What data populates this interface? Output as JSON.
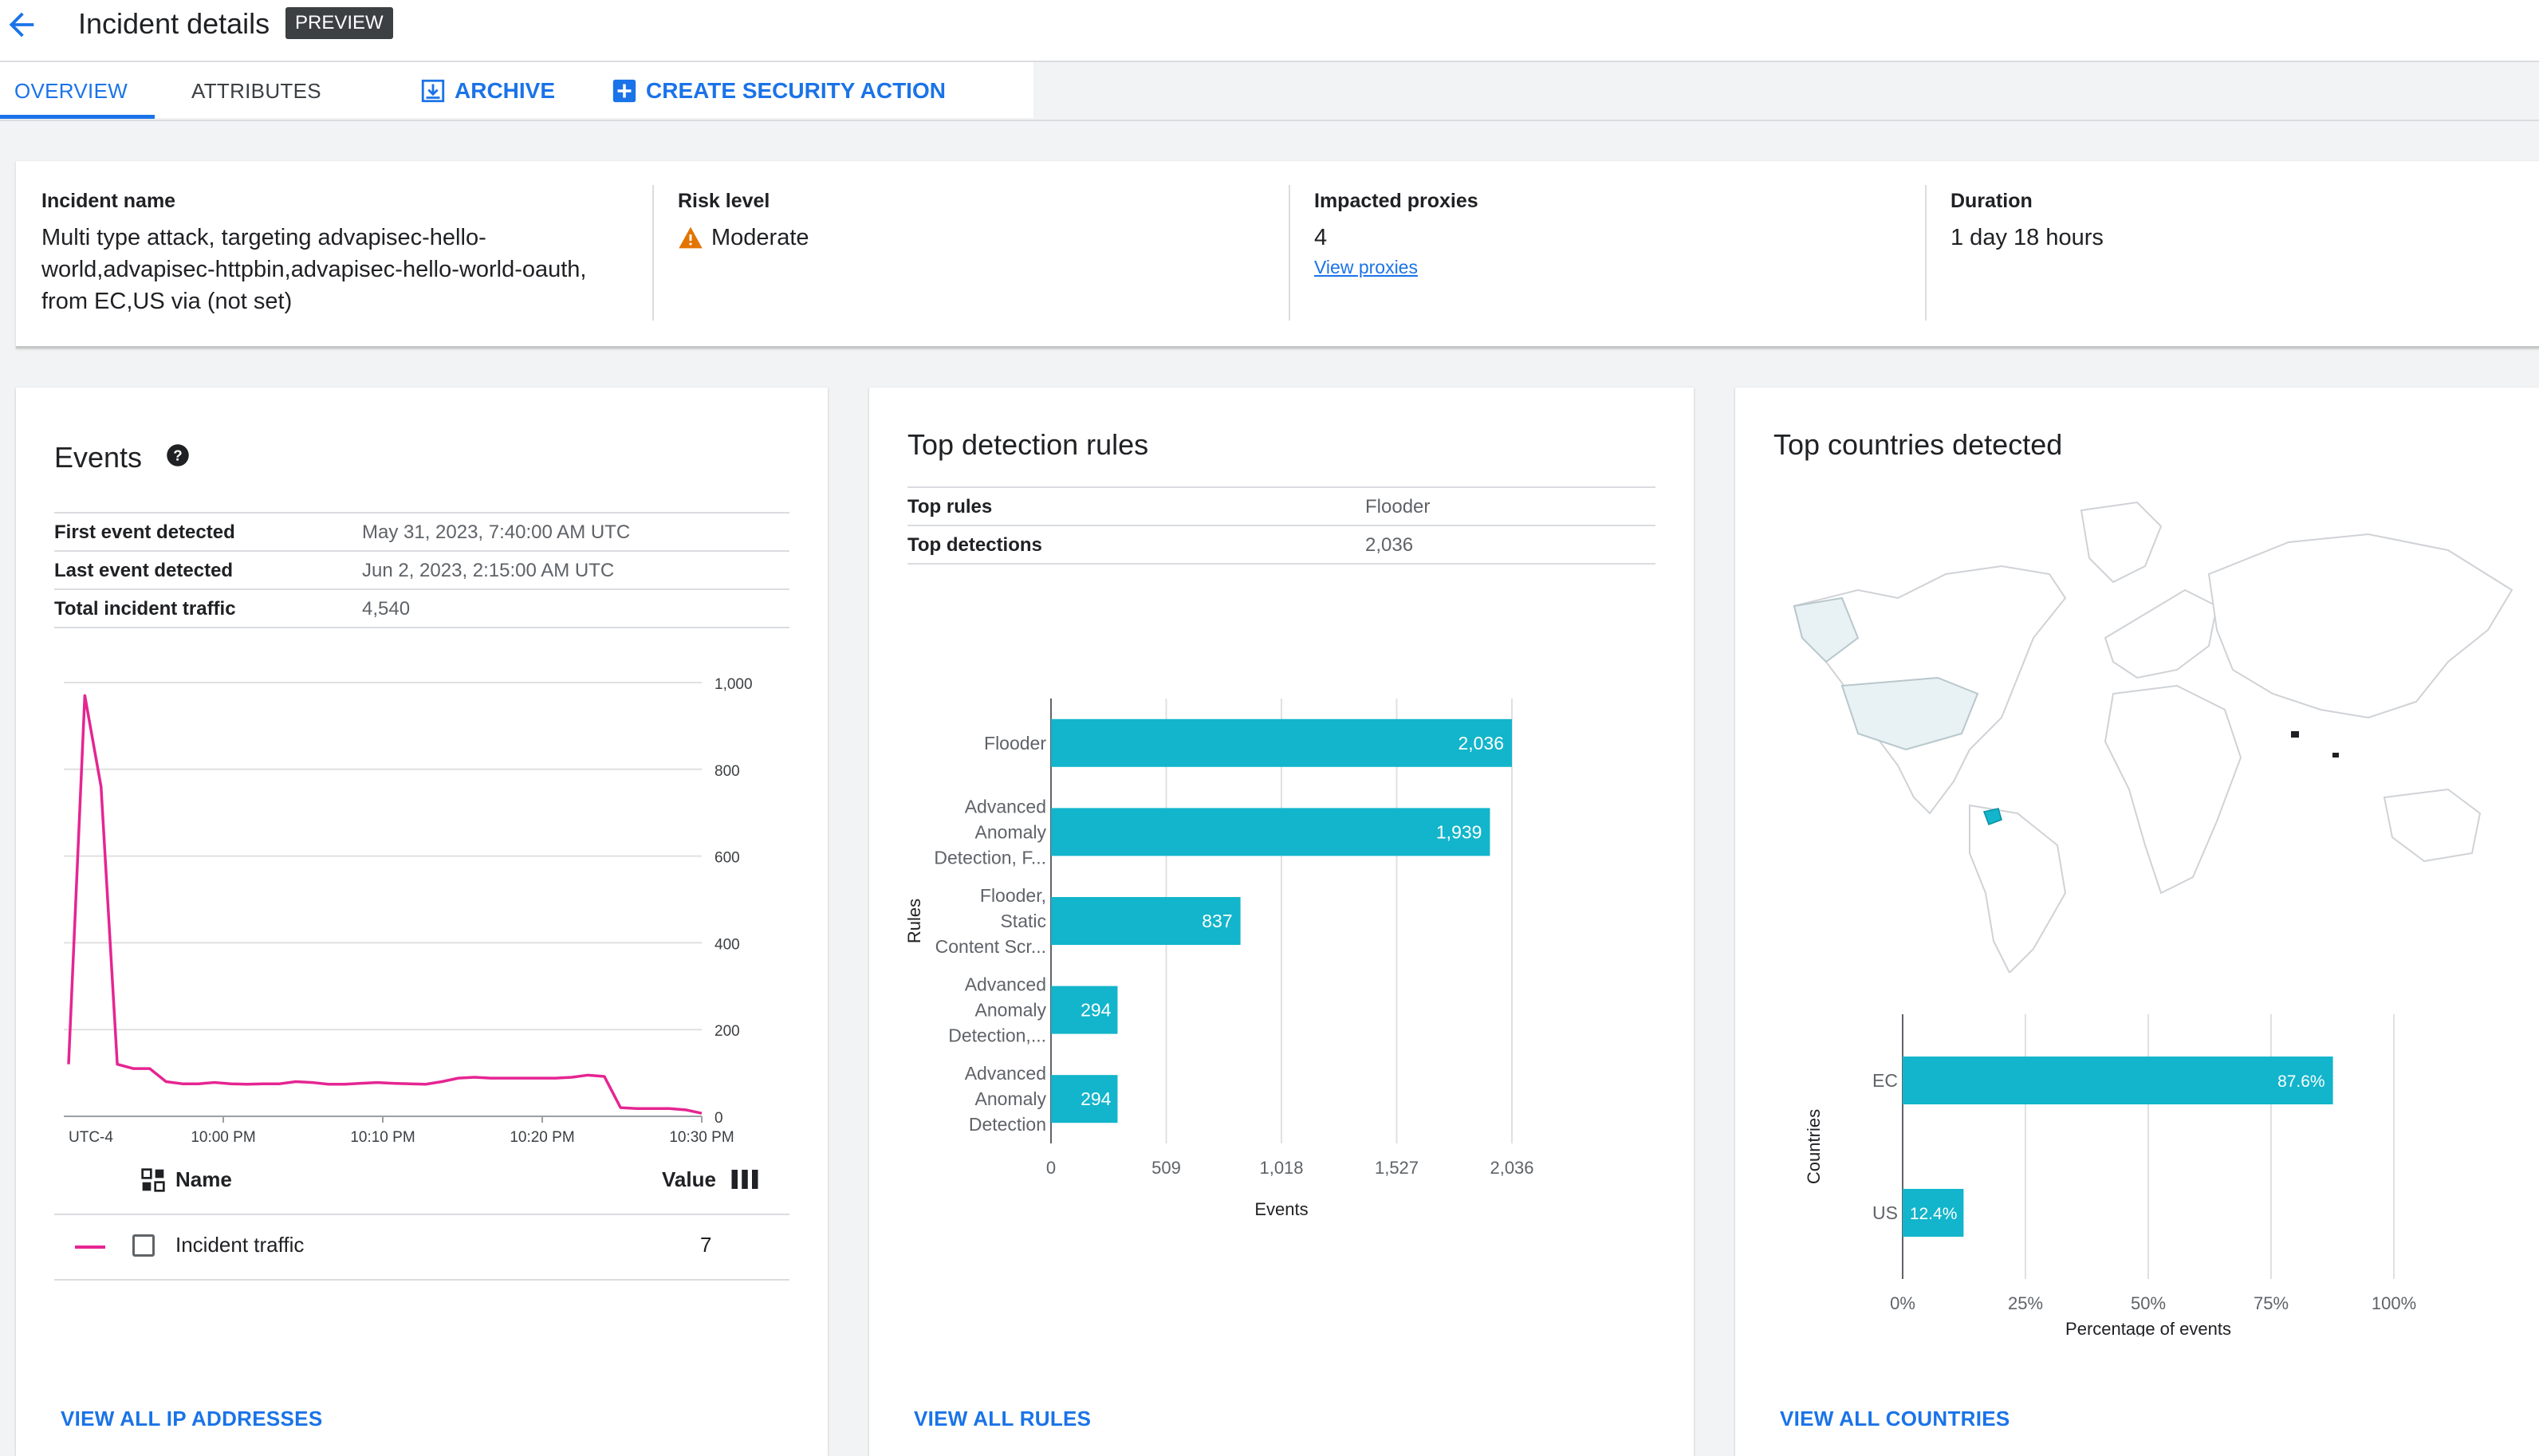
{
  "header": {
    "title": "Incident details",
    "badge": "PREVIEW"
  },
  "tabs": [
    {
      "label": "OVERVIEW",
      "active": true
    },
    {
      "label": "ATTRIBUTES",
      "active": false
    }
  ],
  "actions": {
    "archive": "ARCHIVE",
    "create": "CREATE SECURITY ACTION"
  },
  "summary": {
    "incident_name_label": "Incident name",
    "incident_name_lines": [
      "Multi type attack, targeting advapisec-hello-",
      "world,advapisec-httpbin,advapisec-hello-world-oauth,",
      "from EC,US via (not set)"
    ],
    "risk_label": "Risk level",
    "risk_value": "Moderate",
    "proxies_label": "Impacted proxies",
    "proxies_value": "4",
    "proxies_link": "View proxies",
    "duration_label": "Duration",
    "duration_value": "1 day 18 hours"
  },
  "events": {
    "title": "Events",
    "rows": [
      {
        "key": "First event detected",
        "value": "May 31, 2023, 7:40:00 AM UTC"
      },
      {
        "key": "Last event detected",
        "value": "Jun 2, 2023, 2:15:00 AM UTC"
      },
      {
        "key": "Total incident traffic",
        "value": "4,540"
      }
    ],
    "legend_name_header": "Name",
    "legend_value_header": "Value",
    "legend_series": "Incident traffic",
    "legend_value": "7",
    "footer_link": "VIEW ALL IP ADDRESSES"
  },
  "rules": {
    "title": "Top detection rules",
    "rows": [
      {
        "key": "Top rules",
        "value": "Flooder"
      },
      {
        "key": "Top detections",
        "value": "2,036"
      }
    ],
    "footer_link": "VIEW ALL RULES"
  },
  "countries": {
    "title": "Top countries detected",
    "footer_link": "VIEW ALL COUNTRIES"
  },
  "colors": {
    "accent": "#1a73e8",
    "bar": "#12b5cb",
    "line": "#e52592",
    "warning": "#e37400"
  },
  "chart_data": [
    {
      "type": "line",
      "x_tick_labels": [
        "UTC-4",
        "10:00 PM",
        "10:10 PM",
        "10:20 PM",
        "10:30 PM"
      ],
      "y_tick_labels": [
        "0",
        "200",
        "400",
        "600",
        "800",
        "1,000"
      ],
      "ylim": [
        0,
        1000
      ],
      "series": [
        {
          "name": "Incident traffic",
          "values": [
            120,
            970,
            760,
            120,
            110,
            110,
            80,
            75,
            75,
            78,
            75,
            74,
            75,
            75,
            80,
            78,
            74,
            74,
            76,
            78,
            76,
            75,
            74,
            80,
            88,
            90,
            88,
            88,
            88,
            88,
            88,
            90,
            95,
            92,
            20,
            18,
            18,
            18,
            15,
            7
          ]
        }
      ]
    },
    {
      "type": "bar",
      "orientation": "horizontal",
      "categories": [
        [
          "Flooder"
        ],
        [
          "Advanced",
          "Anomaly",
          "Detection, F..."
        ],
        [
          "Flooder,",
          "Static",
          "Content Scr..."
        ],
        [
          "Advanced",
          "Anomaly",
          "Detection,..."
        ],
        [
          "Advanced",
          "Anomaly",
          "Detection"
        ]
      ],
      "values": [
        2036,
        1939,
        837,
        294,
        294
      ],
      "value_labels": [
        "2,036",
        "1,939",
        "837",
        "294",
        "294"
      ],
      "x_ticks": [
        0,
        509,
        1018,
        1527,
        2036
      ],
      "x_tick_labels": [
        "0",
        "509",
        "1,018",
        "1,527",
        "2,036"
      ],
      "xlim": [
        0,
        2036
      ],
      "xlabel": "Events",
      "ylabel": "Rules"
    },
    {
      "type": "bar",
      "orientation": "horizontal",
      "categories": [
        "EC",
        "US"
      ],
      "values": [
        87.6,
        12.4
      ],
      "value_labels": [
        "87.6%",
        "12.4%"
      ],
      "x_ticks": [
        0,
        25,
        50,
        75,
        100
      ],
      "x_tick_labels": [
        "0%",
        "25%",
        "50%",
        "75%",
        "100%"
      ],
      "xlim": [
        0,
        100
      ],
      "xlabel": "Percentage of events",
      "ylabel": "Countries"
    }
  ]
}
